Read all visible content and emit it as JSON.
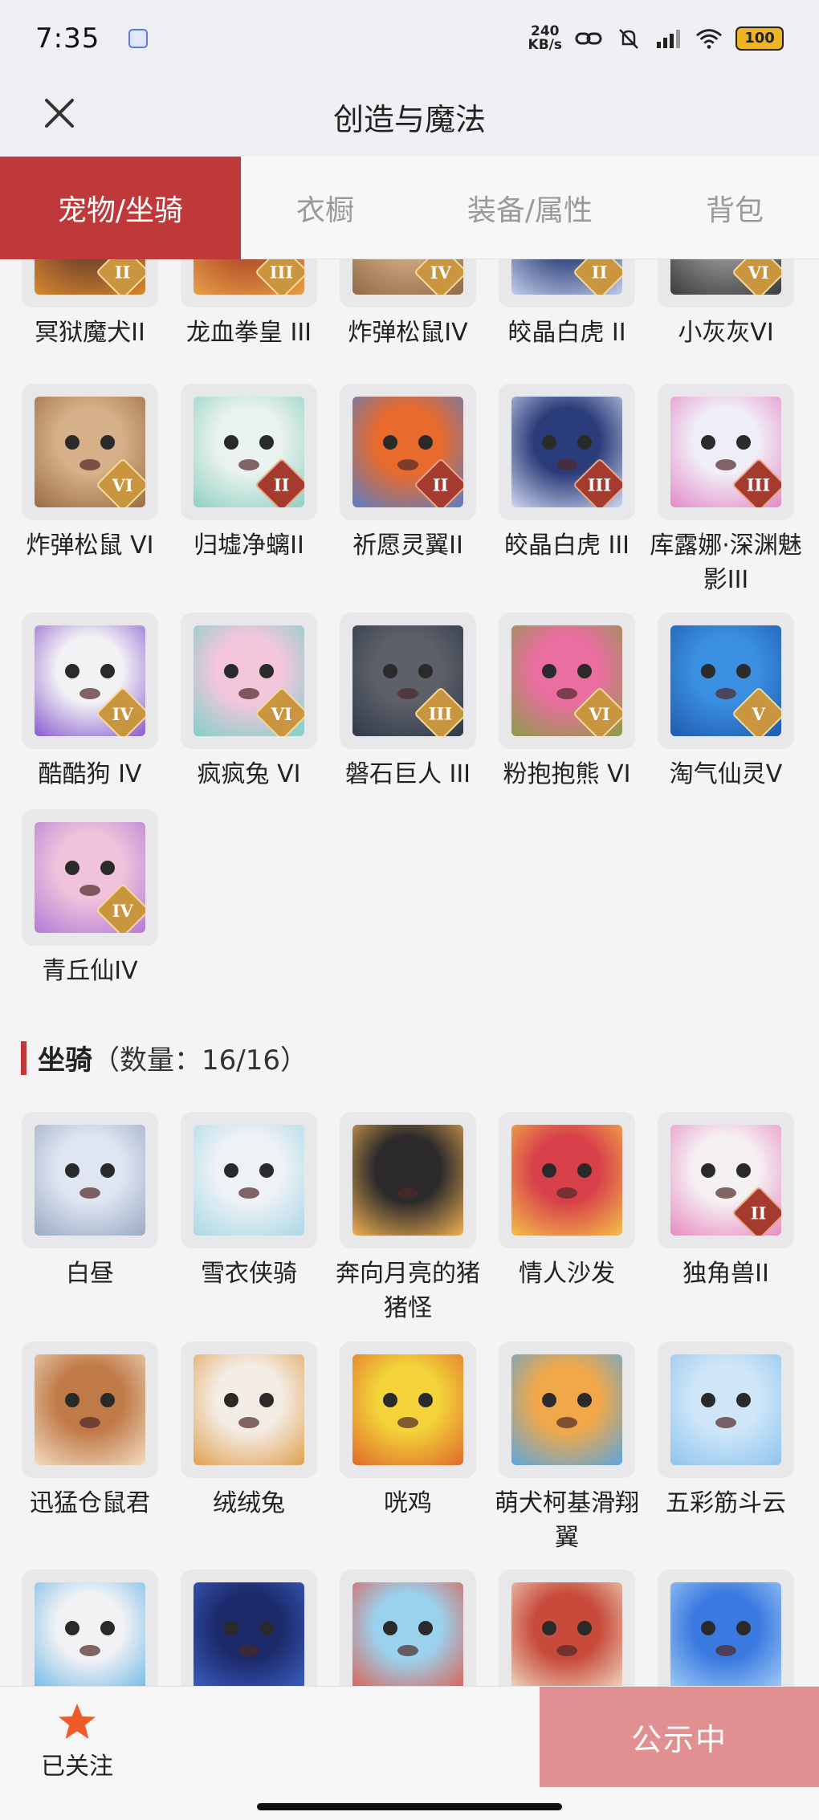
{
  "status_bar": {
    "time": "7:35",
    "net_speed_value": "240",
    "net_speed_unit": "KB/s",
    "battery": "100"
  },
  "header": {
    "title": "创造与魔法"
  },
  "tabs": [
    {
      "label": "宠物/坐骑",
      "active": true
    },
    {
      "label": "衣橱",
      "active": false
    },
    {
      "label": "装备/属性",
      "active": false
    },
    {
      "label": "背包",
      "active": false
    }
  ],
  "pets": [
    {
      "name": "冥狱魔犬II",
      "tier": "II",
      "badge": "gold",
      "colors": [
        "#7a4a2a",
        "#d9882f"
      ],
      "icon": "hellhound-icon"
    },
    {
      "name": "龙血拳皇 III",
      "tier": "III",
      "badge": "gold",
      "colors": [
        "#b8542b",
        "#e8a048"
      ],
      "icon": "dragon-fist-icon"
    },
    {
      "name": "炸弹松鼠IV",
      "tier": "IV",
      "badge": "gold",
      "colors": [
        "#caa27a",
        "#8f6a48"
      ],
      "icon": "bomb-squirrel-icon"
    },
    {
      "name": "皎晶白虎 II",
      "tier": "II",
      "badge": "gold",
      "colors": [
        "#3d4f86",
        "#c2cdea"
      ],
      "icon": "white-tiger-icon"
    },
    {
      "name": "小灰灰VI",
      "tier": "VI",
      "badge": "gold",
      "colors": [
        "#8a8a8c",
        "#3c3c3e"
      ],
      "icon": "little-grey-icon"
    },
    {
      "name": "炸弹松鼠 VI",
      "tier": "VI",
      "badge": "gold",
      "colors": [
        "#d6b088",
        "#9a6d45"
      ],
      "icon": "bomb-squirrel-icon"
    },
    {
      "name": "归墟净螭II",
      "tier": "II",
      "badge": "red",
      "colors": [
        "#e9f2ef",
        "#8fd0c0"
      ],
      "icon": "water-dragon-icon"
    },
    {
      "name": "祈愿灵翼II",
      "tier": "II",
      "badge": "red",
      "colors": [
        "#e86a2c",
        "#5a7ec6"
      ],
      "icon": "wish-wing-icon"
    },
    {
      "name": "皎晶白虎 III",
      "tier": "III",
      "badge": "red",
      "colors": [
        "#2b3c7a",
        "#cfd8f0"
      ],
      "icon": "white-tiger-icon"
    },
    {
      "name": "库露娜·深渊魅影III",
      "tier": "III",
      "badge": "red",
      "colors": [
        "#f0eef6",
        "#e488c8"
      ],
      "icon": "kuluna-icon"
    },
    {
      "name": "酷酷狗 IV",
      "tier": "IV",
      "badge": "gold",
      "colors": [
        "#f2f2f4",
        "#8a5ad0"
      ],
      "icon": "cool-dog-icon"
    },
    {
      "name": "疯疯兔 VI",
      "tier": "VI",
      "badge": "gold",
      "colors": [
        "#f3c6dc",
        "#7fd0c8"
      ],
      "icon": "crazy-rabbit-icon"
    },
    {
      "name": "磐石巨人 III",
      "tier": "III",
      "badge": "gold",
      "colors": [
        "#5d6068",
        "#2f3a4a"
      ],
      "icon": "rock-giant-icon"
    },
    {
      "name": "粉抱抱熊 VI",
      "tier": "VI",
      "badge": "gold",
      "colors": [
        "#ea6ea0",
        "#8c9c4a"
      ],
      "icon": "pink-bear-icon"
    },
    {
      "name": "淘气仙灵V",
      "tier": "V",
      "badge": "gold",
      "colors": [
        "#3a8fe0",
        "#1f5ab0"
      ],
      "icon": "naughty-sprite-icon"
    },
    {
      "name": "青丘仙IV",
      "tier": "IV",
      "badge": "gold",
      "colors": [
        "#f1c2dc",
        "#b27ad6"
      ],
      "icon": "fox-fairy-icon"
    }
  ],
  "mounts_section": {
    "title": "坐骑",
    "count": "（数量：16/16）"
  },
  "mounts": [
    {
      "name": "白昼",
      "tier": "",
      "colors": [
        "#dfe6f2",
        "#9aa8c2"
      ],
      "icon": "white-dragon-icon"
    },
    {
      "name": "雪衣侠骑",
      "tier": "",
      "colors": [
        "#eef2f6",
        "#a9d8e6"
      ],
      "icon": "snow-horse-icon"
    },
    {
      "name": "奔向月亮的猪猪怪",
      "tier": "",
      "colors": [
        "#2c2a2c",
        "#efb050"
      ],
      "icon": "moon-pig-icon"
    },
    {
      "name": "情人沙发",
      "tier": "",
      "colors": [
        "#d8404a",
        "#f3c04a"
      ],
      "icon": "lover-sofa-icon"
    },
    {
      "name": "独角兽II",
      "tier": "II",
      "colors": [
        "#f5f0f2",
        "#e78ac2"
      ],
      "icon": "unicorn-icon"
    },
    {
      "name": "迅猛仓鼠君",
      "tier": "",
      "colors": [
        "#c07a48",
        "#f2dcc2"
      ],
      "icon": "hamster-icon"
    },
    {
      "name": "绒绒兔",
      "tier": "",
      "colors": [
        "#f4ede6",
        "#e0a050"
      ],
      "icon": "fluffy-rabbit-icon"
    },
    {
      "name": "咣鸡",
      "tier": "",
      "colors": [
        "#f3d23a",
        "#e06a2a"
      ],
      "icon": "chicken-icon"
    },
    {
      "name": "萌犬柯基滑翔翼",
      "tier": "",
      "colors": [
        "#f0a84a",
        "#5aa6e0"
      ],
      "icon": "corgi-glider-icon"
    },
    {
      "name": "五彩筋斗云",
      "tier": "",
      "colors": [
        "#cfe6f8",
        "#8ec4ee"
      ],
      "icon": "cloud-icon"
    },
    {
      "name": "",
      "tier": "",
      "colors": [
        "#f2f2f4",
        "#6bb6e6"
      ],
      "icon": "duck-icon"
    },
    {
      "name": "",
      "tier": "",
      "colors": [
        "#1c2a6a",
        "#3c62c8"
      ],
      "icon": "night-horse-icon"
    },
    {
      "name": "",
      "tier": "",
      "colors": [
        "#9ad2ee",
        "#e05a4a"
      ],
      "icon": "fish-icon"
    },
    {
      "name": "",
      "tier": "",
      "colors": [
        "#c84a3a",
        "#f0e0c8"
      ],
      "icon": "snail-icon"
    },
    {
      "name": "",
      "tier": "",
      "colors": [
        "#3a7ae0",
        "#a8d0f8"
      ],
      "icon": "jellyfish-icon"
    }
  ],
  "bottom_bar": {
    "follow_label": "已关注",
    "publicity_label": "公示中"
  },
  "accent_color": "#c0393a"
}
